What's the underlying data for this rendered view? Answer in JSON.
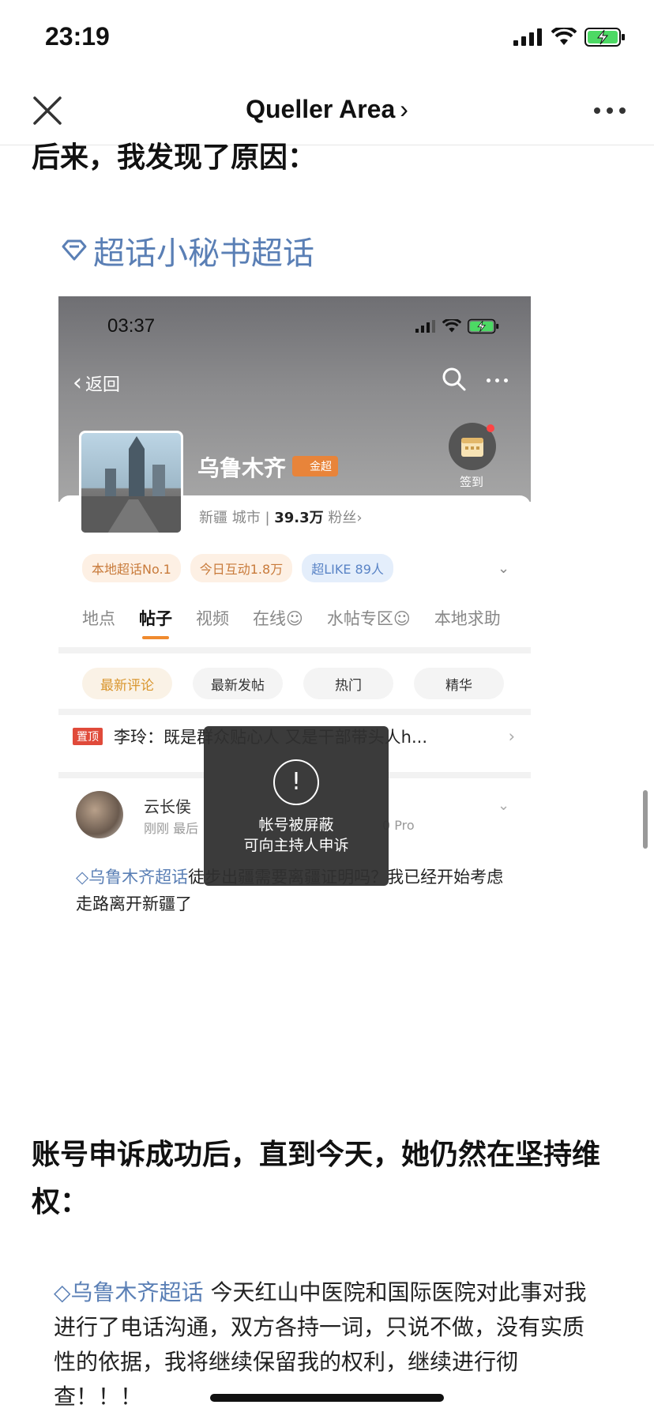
{
  "status_bar": {
    "time": "23:19"
  },
  "nav": {
    "title": "Queller Area",
    "chevron": "›"
  },
  "article": {
    "heading1": "后来，我发现了原因：",
    "topic_title": "超话小秘书超话",
    "heading2": "账号申诉成功后，直到今天，她仍然在坚持维权：",
    "quote_topic": "乌鲁木齐超话",
    "quote_text": " 今天红山中医院和国际医院对此事对我进行了电话沟通，双方各持一词，只说不做，没有实质性的依据，我将继续保留我的权利，继续进行彻查！！！"
  },
  "screenshot": {
    "time": "03:37",
    "back_label": "返回",
    "city_name": "乌鲁木齐",
    "gold_badge": "金超",
    "signin_label": "签到",
    "meta_region": "新疆",
    "meta_type": "城市",
    "meta_fans_count": "39.3万",
    "meta_fans_label": "粉丝",
    "tags": [
      "本地超话No.1",
      "今日互动1.8万",
      "超LIKE 89人"
    ],
    "tabs": [
      "地点",
      "帖子",
      "视频",
      "在线☺",
      "水帖专区☺",
      "本地求助"
    ],
    "active_tab_index": 1,
    "filters": [
      "最新评论",
      "最新发帖",
      "热门",
      "精华"
    ],
    "pinned_badge": "置顶",
    "pinned_text": "李玲：既是群众贴心人 又是干部带头人h...",
    "post_user": "云长侯",
    "post_meta": "刚刚 最后",
    "post_meta_right": "0 Pro",
    "post_topic": "乌鲁木齐超话",
    "post_text": "徒步出疆需要离疆证明吗？我已经开始考虑走路离开新疆了",
    "toast_icon": "!",
    "toast_line1": "帐号被屏蔽",
    "toast_line2": "可向主持人申诉"
  }
}
